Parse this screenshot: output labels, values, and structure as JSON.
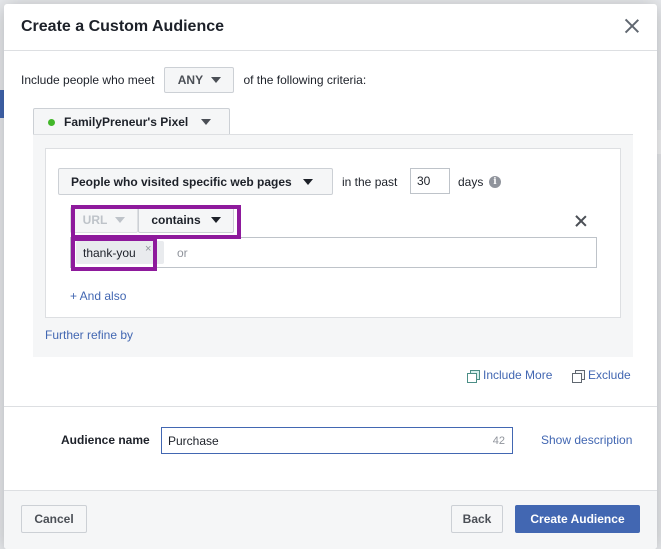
{
  "dialog": {
    "title": "Create a Custom Audience"
  },
  "criteria": {
    "prefix": "Include people who meet",
    "match_value": "ANY",
    "suffix": "of the following criteria:"
  },
  "pixel": {
    "name": "FamilyPreneur's Pixel",
    "status_color": "#42b72a"
  },
  "rule": {
    "event_type": "People who visited specific web pages",
    "in_the_past": "in the past",
    "days_value": "30",
    "days_label": "days",
    "info_glyph": "i",
    "field": "URL",
    "operator": "contains",
    "token": "thank-you",
    "token_remove": "×",
    "token_placeholder": "or",
    "and_also": "+ And also"
  },
  "refine": {
    "label": "Further refine by"
  },
  "actions_row": {
    "include_more": "Include More",
    "exclude": "Exclude"
  },
  "audience": {
    "label": "Audience name",
    "value": "Purchase",
    "char_count": "42",
    "show_description": "Show description"
  },
  "footer": {
    "cancel": "Cancel",
    "back": "Back",
    "create": "Create Audience"
  },
  "colors": {
    "accent": "#4267b2",
    "highlight": "#8e1a9c"
  }
}
